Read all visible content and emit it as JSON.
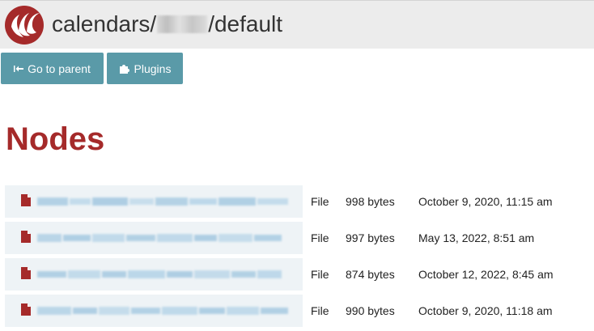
{
  "header": {
    "title_prefix": "calendars/",
    "title_suffix": "/default",
    "logo_icon": "app-logo-icon"
  },
  "toolbar": {
    "parent_label": "Go to parent",
    "parent_icon": "arrow-left-bar-icon",
    "plugins_label": "Plugins",
    "plugins_icon": "puzzle-icon"
  },
  "colors": {
    "brand_red": "#a52a2a",
    "button_teal": "#5a9aa8",
    "header_bg": "#ececec",
    "row_bg": "#eef3f6"
  },
  "main": {
    "heading": "Nodes",
    "nodes": [
      {
        "type": "File",
        "size": "998 bytes",
        "modified": "October 9, 2020, 11:15 am"
      },
      {
        "type": "File",
        "size": "997 bytes",
        "modified": "May 13, 2022, 8:51 am"
      },
      {
        "type": "File",
        "size": "874 bytes",
        "modified": "October 12, 2022, 8:45 am"
      },
      {
        "type": "File",
        "size": "990 bytes",
        "modified": "October 9, 2020, 11:18 am"
      }
    ]
  }
}
